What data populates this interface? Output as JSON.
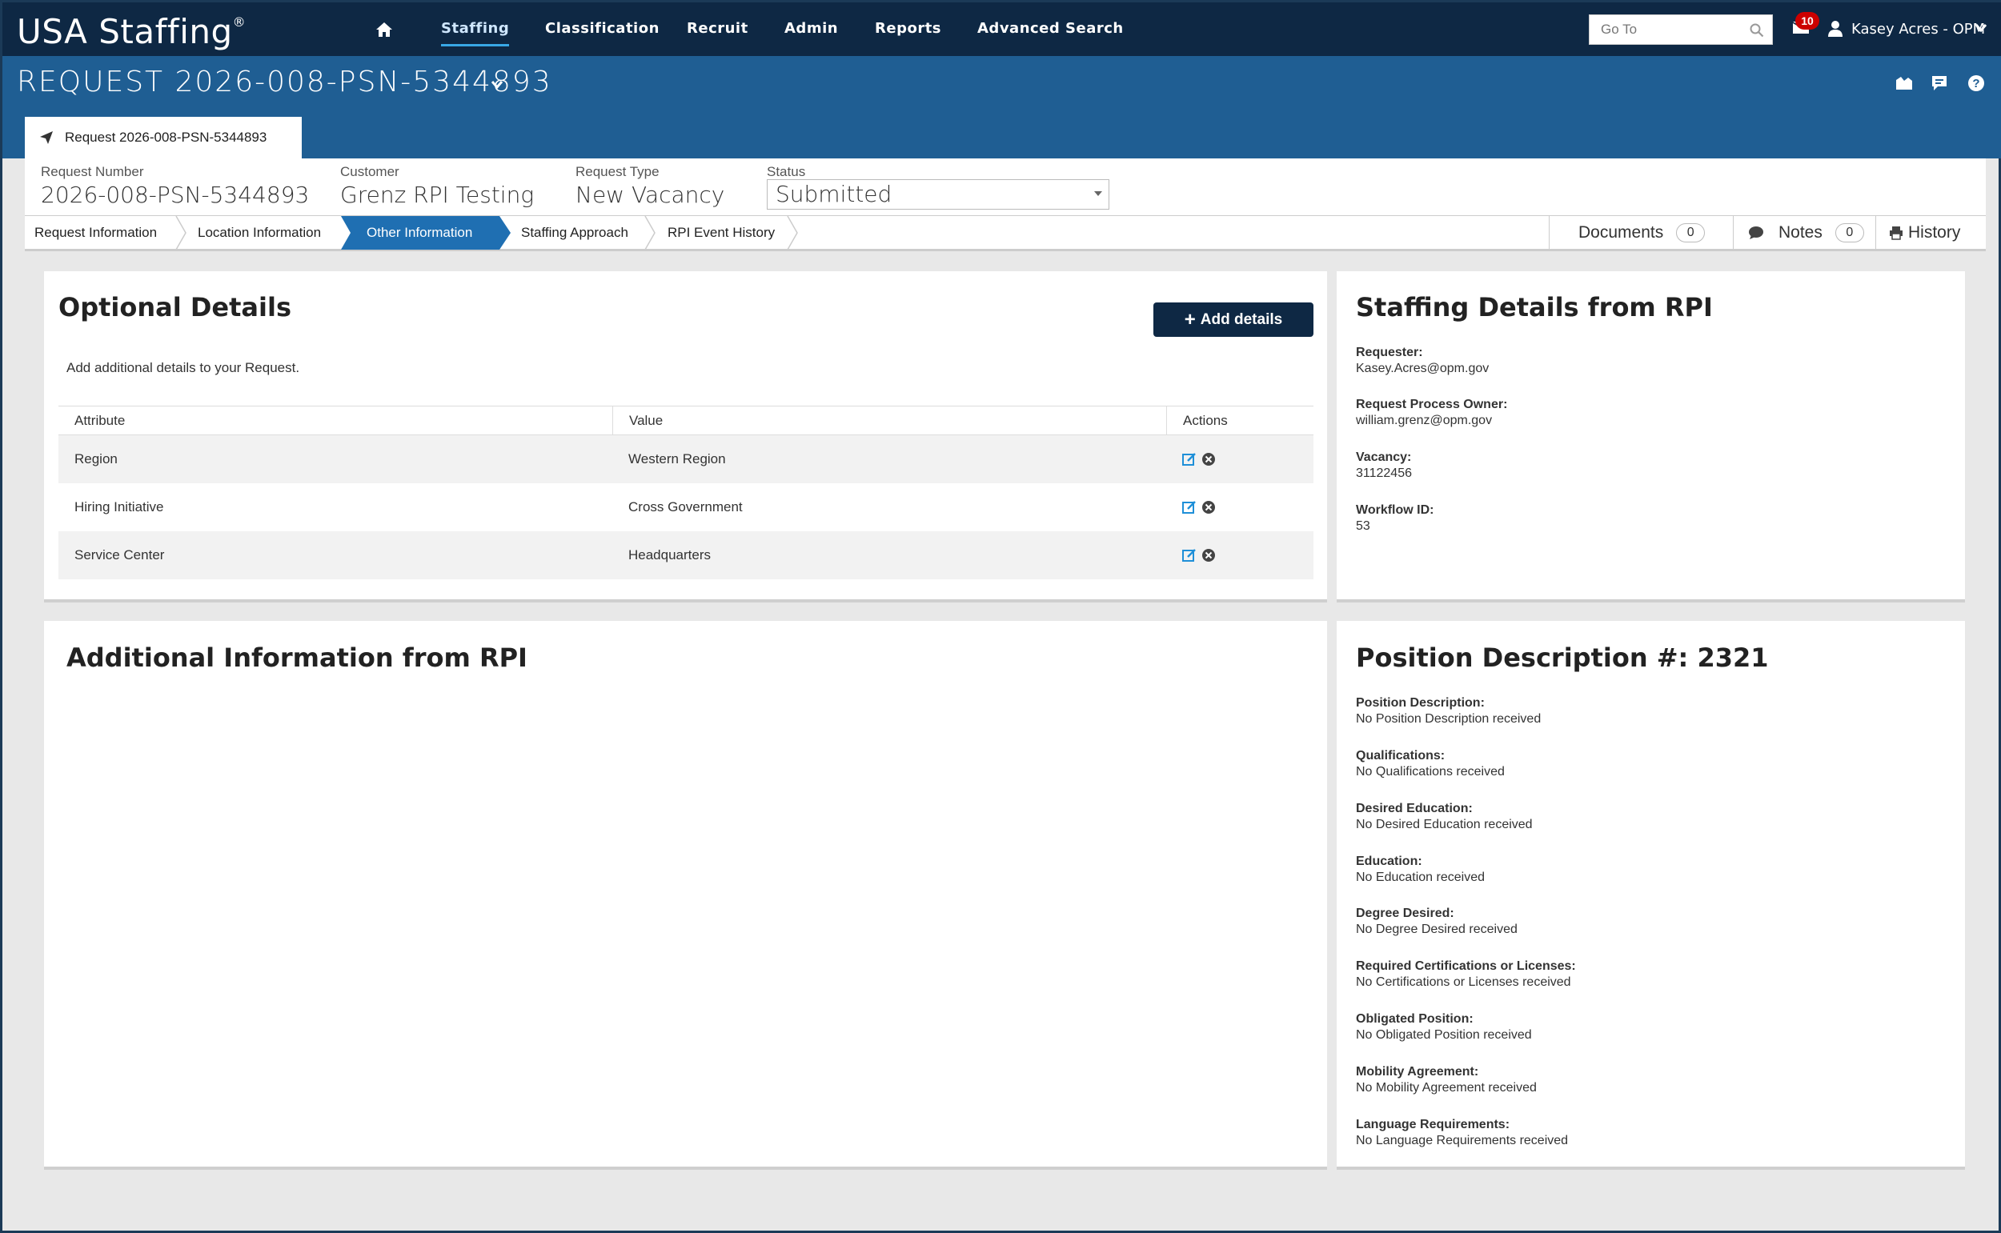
{
  "nav": {
    "brand": "USA Staffing",
    "items": [
      "Staffing",
      "Classification",
      "Recruit",
      "Admin",
      "Reports",
      "Advanced Search"
    ],
    "active": "Staffing",
    "goto_placeholder": "Go To",
    "notifications_count": "10",
    "user": "Kasey Acres - OPM"
  },
  "header": {
    "title": "REQUEST 2026-008-PSN-5344893",
    "tab_label": "Request 2026-008-PSN-5344893"
  },
  "summary": {
    "request_number_label": "Request Number",
    "request_number": "2026-008-PSN-5344893",
    "customer_label": "Customer",
    "customer": "Grenz RPI Testing",
    "request_type_label": "Request Type",
    "request_type": "New Vacancy",
    "status_label": "Status",
    "status": "Submitted"
  },
  "crumbs": [
    "Request Information",
    "Location Information",
    "Other Information",
    "Staffing Approach",
    "RPI Event History"
  ],
  "active_crumb": "Other Information",
  "side_tabs": {
    "documents_label": "Documents",
    "documents_count": "0",
    "notes_label": "Notes",
    "notes_count": "0",
    "history_label": "History"
  },
  "optional_details": {
    "title": "Optional Details",
    "add_button": "Add details",
    "hint": "Add additional details to your Request.",
    "columns": [
      "Attribute",
      "Value",
      "Actions"
    ],
    "rows": [
      {
        "attribute": "Region",
        "value": "Western Region"
      },
      {
        "attribute": "Hiring Initiative",
        "value": "Cross Government"
      },
      {
        "attribute": "Service Center",
        "value": "Headquarters"
      }
    ]
  },
  "staffing_details": {
    "title": "Staffing Details from RPI",
    "fields": [
      {
        "label": "Requester:",
        "value": "Kasey.Acres@opm.gov"
      },
      {
        "label": "Request Process Owner:",
        "value": "william.grenz@opm.gov"
      },
      {
        "label": "Vacancy:",
        "value": "31122456"
      },
      {
        "label": "Workflow ID:",
        "value": "53"
      }
    ]
  },
  "additional_info": {
    "title": "Additional Information from RPI"
  },
  "position_description": {
    "title": "Position Description #: 2321",
    "fields": [
      {
        "label": "Position Description:",
        "value": "No Position Description received"
      },
      {
        "label": "Qualifications:",
        "value": "No Qualifications received"
      },
      {
        "label": "Desired Education:",
        "value": "No Desired Education received"
      },
      {
        "label": "Education:",
        "value": "No Education received"
      },
      {
        "label": "Degree Desired:",
        "value": "No Degree Desired received"
      },
      {
        "label": "Required Certifications or Licenses:",
        "value": "No Certifications or Licenses received"
      },
      {
        "label": "Obligated Position:",
        "value": "No Obligated Position received"
      },
      {
        "label": "Mobility Agreement:",
        "value": "No Mobility Agreement received"
      },
      {
        "label": "Language Requirements:",
        "value": "No Language Requirements received"
      }
    ]
  },
  "colors": {
    "nav_bg": "#0e2844",
    "header_bg": "#1f5e93",
    "active_tab": "#1f6fb2",
    "accent": "#38a8e6",
    "badge": "#cc0000"
  }
}
